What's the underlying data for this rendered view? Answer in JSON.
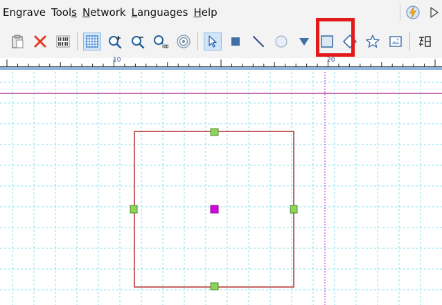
{
  "menubar": {
    "items": [
      {
        "label": "Engrave"
      },
      {
        "label": "Tools"
      },
      {
        "label": "Network"
      },
      {
        "label": "Languages"
      },
      {
        "label": "Help"
      }
    ]
  },
  "toolbar": {
    "tools": [
      {
        "icon": "clipboard-icon"
      },
      {
        "icon": "delete-icon"
      },
      {
        "icon": "barcode-icon"
      },
      {
        "icon": "grid-icon",
        "active": true
      },
      {
        "icon": "zoom-in-icon"
      },
      {
        "icon": "zoom-out-icon"
      },
      {
        "icon": "zoom-100-icon"
      },
      {
        "icon": "zoom-fit-icon"
      },
      {
        "icon": "select-arrow-icon",
        "active": true
      },
      {
        "icon": "filled-rectangle-icon"
      },
      {
        "icon": "line-icon"
      },
      {
        "icon": "circle-icon"
      },
      {
        "icon": "triangle-icon"
      },
      {
        "icon": "rectangle-icon"
      },
      {
        "icon": "diamond-icon"
      },
      {
        "icon": "star-icon"
      },
      {
        "icon": "image-icon"
      },
      {
        "icon": "text-icon"
      }
    ],
    "highlighted_tool": "rectangle-icon"
  },
  "ruler": {
    "labels": [
      "10",
      "20"
    ]
  },
  "colors": {
    "grid": "#7fe3ea",
    "shape_stroke": "#b22222",
    "handle_fill": "#8fd45a",
    "center_fill": "#d10ad9",
    "guide_line": "#a0267a",
    "highlight": "#e21a1a"
  }
}
